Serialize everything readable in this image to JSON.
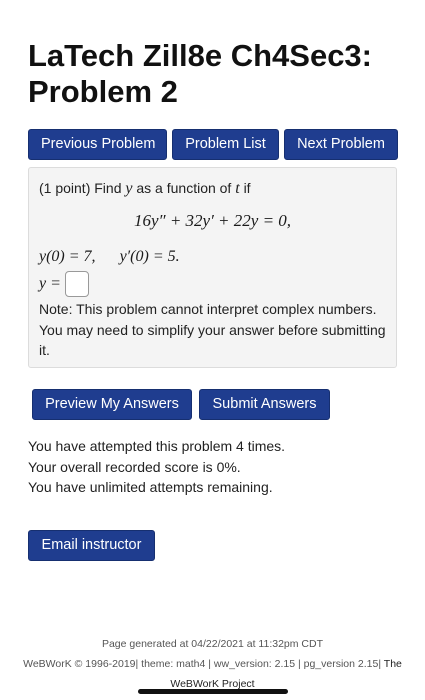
{
  "page": {
    "title": "LaTech Zill8e Ch4Sec3: Problem 2"
  },
  "nav": {
    "previous": "Previous Problem",
    "list": "Problem List",
    "next": "Next Problem"
  },
  "problem": {
    "points": "(1 point)",
    "find_text": "Find",
    "var_y": "y",
    "as_function_text": "as a function of",
    "var_t": "t",
    "if_text": "if",
    "equation": "16y″ + 32y′ + 22y = 0,",
    "ic1": "y(0) = 7,",
    "ic2": "y′(0) = 5.",
    "answer_label": "y =",
    "answer_value": "",
    "note": "Note: This problem cannot interpret complex numbers. You may need to simplify your answer before submitting it."
  },
  "actions": {
    "preview": "Preview My Answers",
    "submit": "Submit Answers"
  },
  "status": {
    "attempted": "You have attempted this problem 4 times.",
    "score": "Your overall recorded score is 0%.",
    "remaining": "You have unlimited attempts remaining."
  },
  "email": {
    "label": "Email instructor"
  },
  "footer": {
    "generated": "Page generated at 04/22/2021 at 11:32pm CDT",
    "copyright": "WeBWorK © 1996-2019| theme: math4 | ww_version: 2.15 | pg_version 2.15|",
    "project": "The WeBWorK Project"
  }
}
